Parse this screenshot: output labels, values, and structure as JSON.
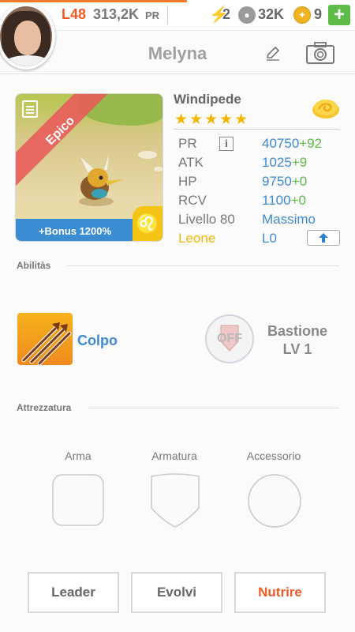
{
  "topbar": {
    "level": "L48",
    "power": "313,2K",
    "power_unit": "PR",
    "energy": "2",
    "paws": "32K",
    "coins": "9",
    "add_label": "+"
  },
  "header": {
    "player_name": "Melyna"
  },
  "pet": {
    "name": "Windipede",
    "rarity": "Epico",
    "stars": 5,
    "bonus": "+Bonus 1200%",
    "zodiac_symbol": "♌",
    "stats": {
      "pr": {
        "label": "PR",
        "value": "40750",
        "bonus": "+92"
      },
      "atk": {
        "label": "ATK",
        "value": "1025",
        "bonus": "+9"
      },
      "hp": {
        "label": "HP",
        "value": "9750",
        "bonus": "+0"
      },
      "rcv": {
        "label": "RCV",
        "value": "1100",
        "bonus": "+0"
      },
      "level": {
        "label": "Livello 80",
        "value": "Massimo"
      },
      "zodiac": {
        "label": "Leone",
        "value": "L0"
      }
    }
  },
  "skills": {
    "title": "Abilitàs",
    "skill1": {
      "name": "Colpo"
    },
    "skill2": {
      "toggle": "OFF",
      "name": "Bastione",
      "level": "LV 1"
    }
  },
  "equipment": {
    "title": "Attrezzatura",
    "slots": [
      "Arma",
      "Armatura",
      "Accessorio"
    ]
  },
  "actions": {
    "leader": "Leader",
    "evolve": "Evolvi",
    "feed": "Nutrire"
  },
  "colors": {
    "accent_orange": "#f05a24",
    "stat_blue": "#3f8ad0",
    "bonus_green": "#5dbb46",
    "zodiac_yellow": "#f4c415",
    "rarity_red": "#e85a5a"
  }
}
